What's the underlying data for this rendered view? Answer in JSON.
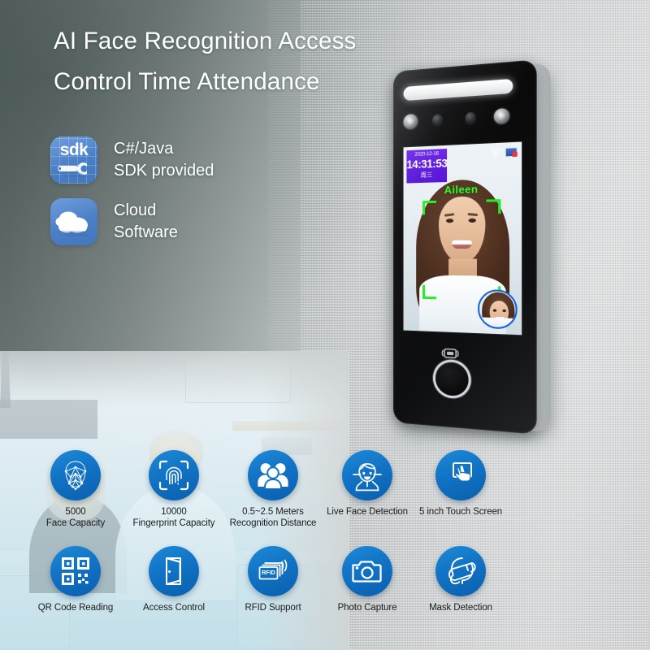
{
  "headline": "AI Face Recognition Access\nControl Time Attendance",
  "colors": {
    "accent_blue": "#1274c6",
    "badge_blue": "#4a7fc6",
    "screen_purple": "#5c17dd",
    "detect_green": "#22ee22",
    "thumb_ring_blue": "#1565d8",
    "alert_red": "#e33b3b"
  },
  "badges": [
    {
      "icon": "sdk-icon",
      "icon_text": "sdk",
      "label": "C#/Java\nSDK provided"
    },
    {
      "icon": "cloud-icon",
      "icon_text": "",
      "label": "Cloud\nSoftware"
    }
  ],
  "device": {
    "name": "face-recognition-terminal",
    "led_bar": "white-light-bar",
    "sensors": [
      "ir-light-left",
      "camera-left",
      "camera-right",
      "ir-light-right"
    ],
    "screen": {
      "date": "2020-12-16",
      "time": "14:31:53",
      "weekday": "周三",
      "person_name": "Aileen",
      "status_icons": [
        "wifi-icon",
        "network-icon"
      ],
      "detection_frame": "green-face-brackets",
      "thumbnail": "matched-face-thumbnail"
    },
    "card_reader_icon": "rfid-card-icon",
    "fingerprint_sensor": "fingerprint-button"
  },
  "features": [
    {
      "icon": "face-mesh-icon",
      "label": "5000\nFace Capacity"
    },
    {
      "icon": "fingerprint-scan-icon",
      "label": "10000\nFingerprint Capacity"
    },
    {
      "icon": "people-group-icon",
      "label": "0.5~2.5 Meters\nRecognition Distance"
    },
    {
      "icon": "live-face-icon",
      "label": "Live Face Detection"
    },
    {
      "icon": "touch-screen-icon",
      "label": "5 inch Touch Screen"
    },
    {
      "icon": "qr-code-icon",
      "label": "QR Code Reading"
    },
    {
      "icon": "open-door-icon",
      "label": "Access Control"
    },
    {
      "icon": "rfid-card-icon",
      "label": "RFID Support"
    },
    {
      "icon": "camera-icon",
      "label": "Photo Capture"
    },
    {
      "icon": "face-mask-icon",
      "label": "Mask Detection"
    }
  ]
}
